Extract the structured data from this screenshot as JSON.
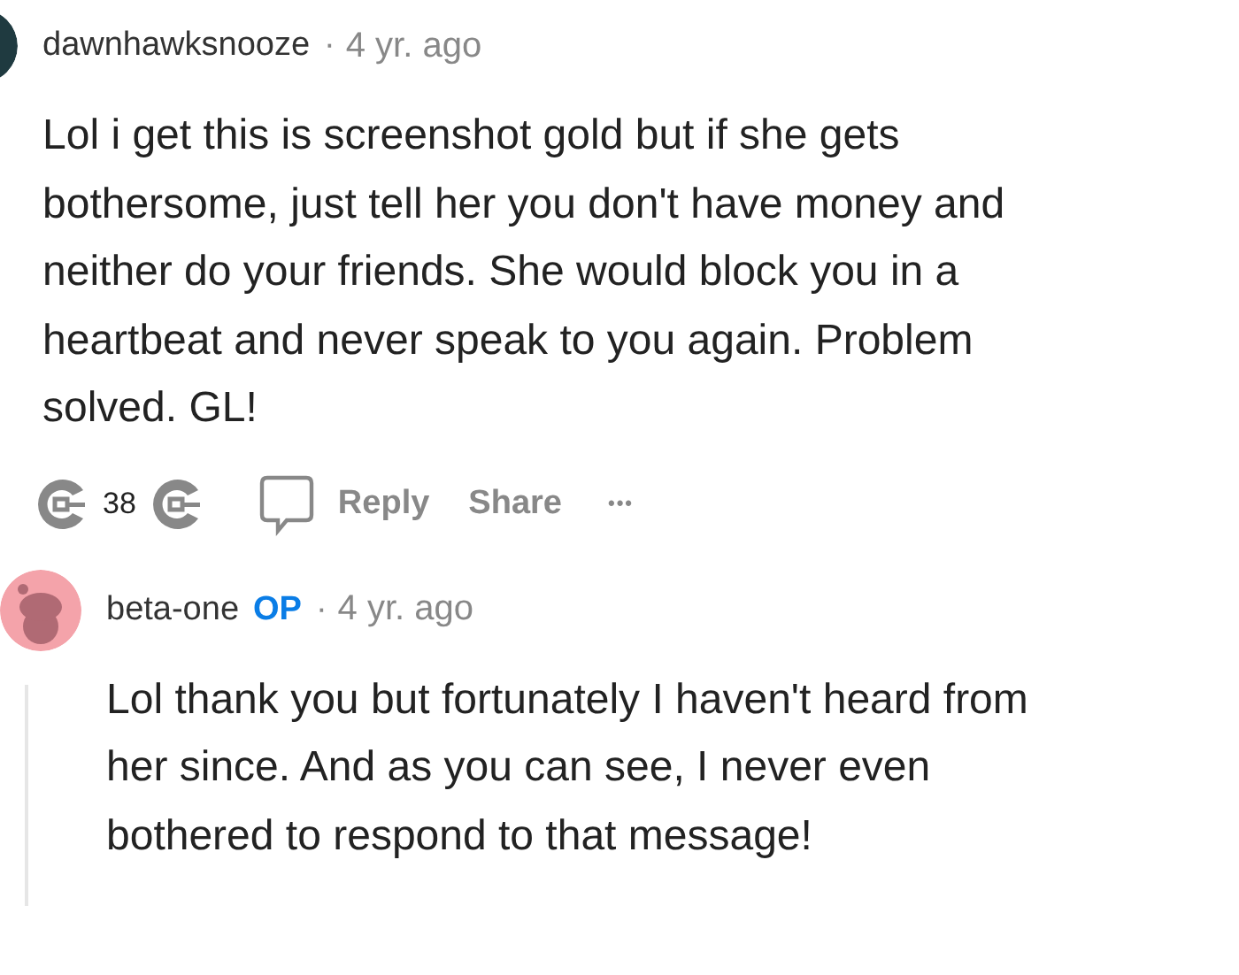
{
  "comments": [
    {
      "kind": "top",
      "avatar": {
        "color": "#1f3a40"
      },
      "username": "dawnhawksnooze",
      "separator": "·",
      "time": "4 yr. ago",
      "body": "Lol i get this is screenshot gold but if she gets bothersome, just tell her you don't have money and neither do your friends. She would block you in a heartbeat and never speak to you again. Problem solved. GL!",
      "actions": {
        "votes": "38",
        "reply": "Reply",
        "share": "Share",
        "more": "•••"
      }
    },
    {
      "kind": "reply",
      "avatar": {
        "color": "#f4a3aa"
      },
      "username": "beta-one",
      "op_badge": "OP",
      "separator": "·",
      "time": "4 yr. ago",
      "body": "Lol thank you but fortunately I haven't heard from her since. And as you can see, I never even bothered to respond to that message!"
    }
  ]
}
